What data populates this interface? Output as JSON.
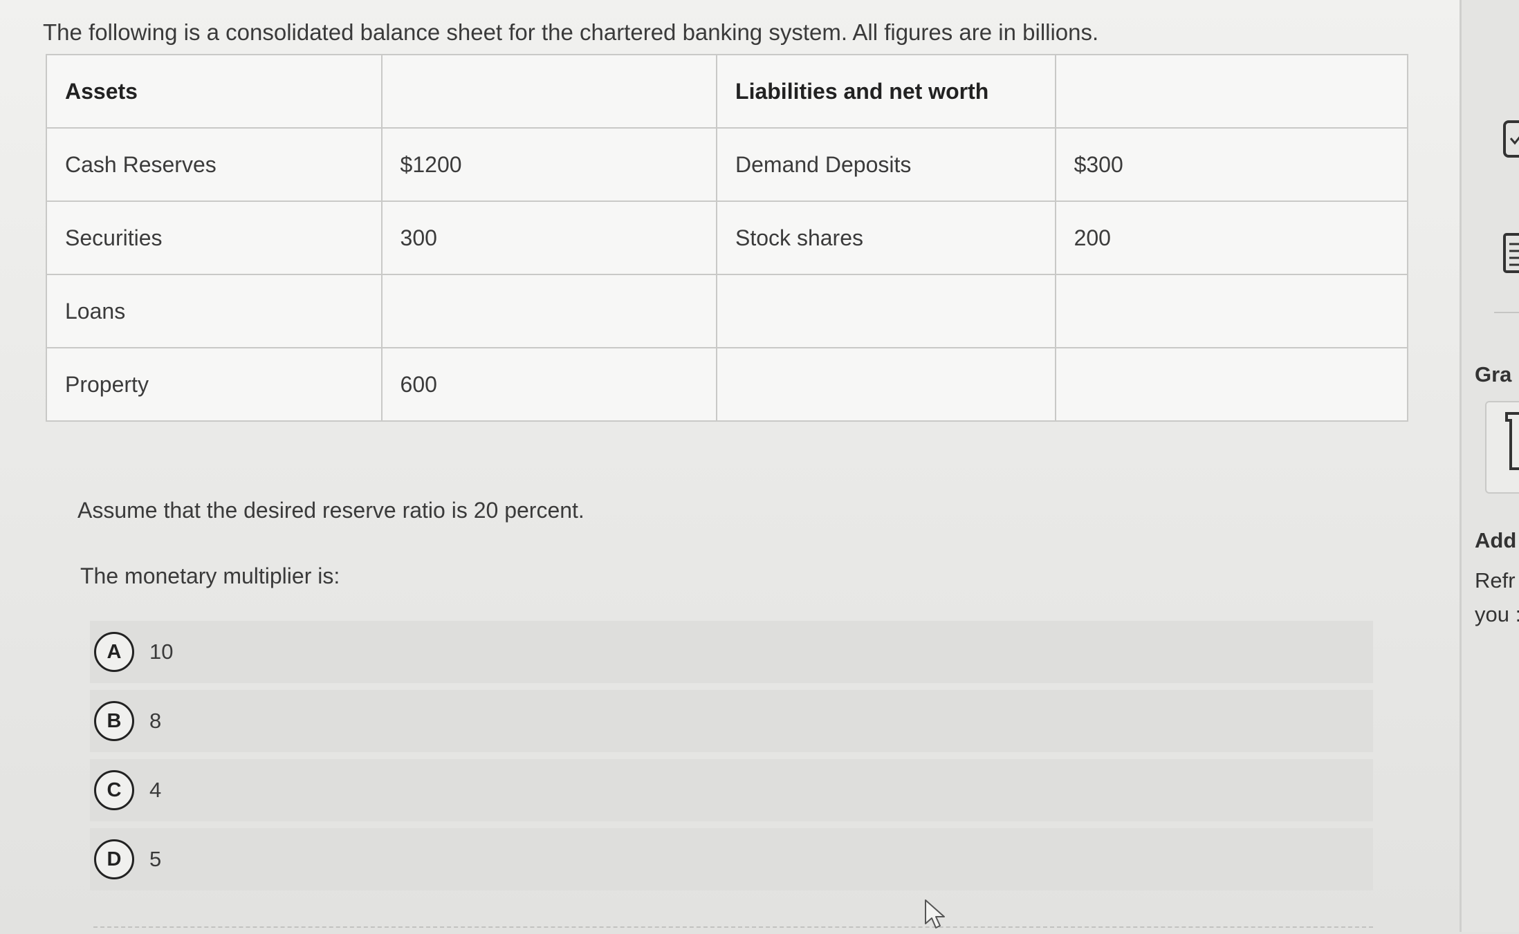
{
  "question": {
    "intro": "The following is a consolidated balance sheet for the chartered banking system. All figures are in billions.",
    "balance_sheet": {
      "headers": [
        "Assets",
        "",
        "Liabilities and net worth",
        ""
      ],
      "rows": [
        [
          "Cash Reserves",
          "$1200",
          "Demand Deposits",
          "$300"
        ],
        [
          "Securities",
          "300",
          "Stock shares",
          "200"
        ],
        [
          "Loans",
          "",
          "",
          ""
        ],
        [
          "Property",
          "600",
          "",
          ""
        ]
      ]
    },
    "assumption": "Assume that the desired reserve ratio is 20 percent.",
    "prompt": "The monetary multiplier is:",
    "options": [
      {
        "letter": "A",
        "text": "10"
      },
      {
        "letter": "B",
        "text": "8"
      },
      {
        "letter": "C",
        "text": "4"
      },
      {
        "letter": "D",
        "text": "5"
      }
    ]
  },
  "right_panel": {
    "grade_label": "Gra",
    "add_label": "Add",
    "line1": "Refr",
    "line2": "you :"
  },
  "icons": {
    "top": "clipboard-icon",
    "mid": "document-list-icon",
    "grade": "bracket-icon",
    "cursor": "mouse-pointer-icon"
  }
}
